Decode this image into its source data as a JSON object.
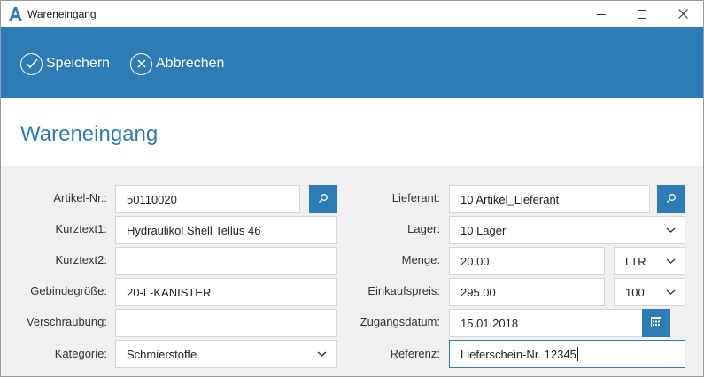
{
  "window": {
    "title": "Wareneingang",
    "app_icon": "app-logo-a",
    "controls": [
      "minimize-icon",
      "maximize-icon",
      "close-icon"
    ]
  },
  "toolbar": {
    "save_label": "Speichern",
    "cancel_label": "Abbrechen",
    "background": "#2e7cb5"
  },
  "page": {
    "title": "Wareneingang"
  },
  "form": {
    "left": {
      "artikel_nr": {
        "label": "Artikel-Nr.:",
        "value": "50110020"
      },
      "kurztext1": {
        "label": "Kurztext1:",
        "value": "Hydrauliköl Shell Tellus 46"
      },
      "kurztext2": {
        "label": "Kurztext2:",
        "value": ""
      },
      "gebindegroesse": {
        "label": "Gebindegröße:",
        "value": "20-L-KANISTER"
      },
      "verschraubung": {
        "label": "Verschraubung:",
        "value": ""
      },
      "kategorie": {
        "label": "Kategorie:",
        "value": "Schmierstoffe"
      }
    },
    "right": {
      "lieferant": {
        "label": "Lieferant:",
        "value": "10 Artikel_Lieferant"
      },
      "lager": {
        "label": "Lager:",
        "value": "10 Lager"
      },
      "menge": {
        "label": "Menge:",
        "value": "20.00",
        "unit": "LTR"
      },
      "einkaufspreis": {
        "label": "Einkaufspreis:",
        "value": "295.00",
        "per": "100"
      },
      "zugangsdatum": {
        "label": "Zugangsdatum:",
        "value": "15.01.2018"
      },
      "referenz": {
        "label": "Referenz:",
        "value": "Lieferschein-Nr. 12345"
      }
    }
  },
  "colors": {
    "accent": "#2e7cb5",
    "form_background": "#f0f0f0",
    "field_border": "#d6d6d6"
  }
}
